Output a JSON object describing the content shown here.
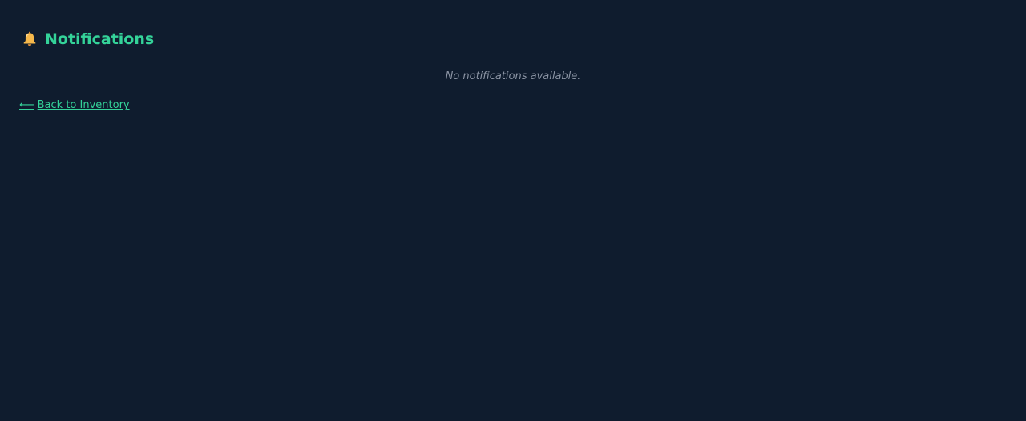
{
  "header": {
    "icon": "bell-icon",
    "title": "Notifications"
  },
  "main": {
    "empty_message": "No notifications available."
  },
  "nav": {
    "back_arrow": "⟵",
    "back_label": "Back to Inventory"
  },
  "colors": {
    "background": "#0f1c2e",
    "accent": "#34d399",
    "muted_text": "#8a93a3",
    "bell": "#f6b84b"
  }
}
